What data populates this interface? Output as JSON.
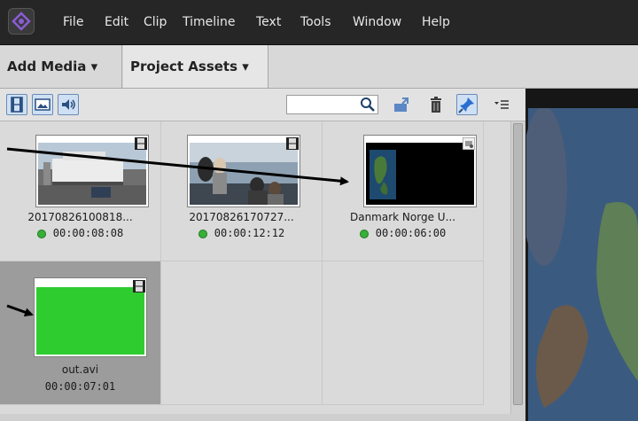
{
  "menu": {
    "items": [
      "File",
      "Edit",
      "Clip",
      "Timeline",
      "Text",
      "Tools",
      "Window",
      "Help"
    ]
  },
  "tabs": {
    "add_media": "Add Media ▾",
    "project_assets": "Project Assets ▾"
  },
  "toolbar": {
    "search_value": "",
    "view_buttons": [
      "video-filter-icon",
      "image-filter-icon",
      "audio-filter-icon"
    ],
    "actions": [
      "search-icon",
      "import-icon",
      "delete-icon",
      "pin-icon",
      "panel-menu-icon"
    ]
  },
  "assets": [
    {
      "name": "20170826100818...",
      "duration": "00:00:08:08",
      "type": "video",
      "used": true
    },
    {
      "name": "20170826170727...",
      "duration": "00:00:12:12",
      "type": "video",
      "used": true
    },
    {
      "name": "Danmark Norge U...",
      "duration": "00:00:06:00",
      "type": "image",
      "used": true
    },
    {
      "name": "out.avi",
      "duration": "00:00:07:01",
      "type": "video",
      "used": false,
      "selected": true
    }
  ],
  "colors": {
    "status_green": "#38b038",
    "green_screen": "#2fcc2f",
    "menu_bg": "#262626",
    "panel_bg": "#dadada"
  }
}
